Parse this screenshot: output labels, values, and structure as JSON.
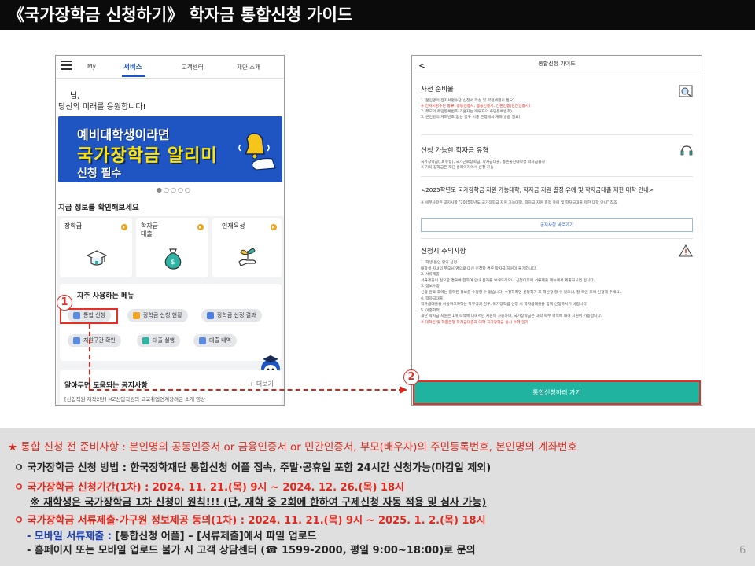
{
  "slide": {
    "title": "《국가장학금 신청하기》 학자금 통합신청 가이드",
    "page_number": "6"
  },
  "left_phone": {
    "nav": {
      "my": "My",
      "service": "서비스",
      "customer_center": "고객센터",
      "foundation": "재단 소개"
    },
    "greeting_line1": "님,",
    "greeting_line2": "당신의 미래를 응원합니다!",
    "banner": {
      "line1": "예비대학생이라면",
      "line2": "국가장학금 알리미",
      "line3": "신청 필수"
    },
    "carousel_dots": "●○○○○",
    "info_title": "지금 정보를 확인해보세요",
    "cards": [
      {
        "label": "장학금"
      },
      {
        "label": "학자금\n대출"
      },
      {
        "label": "인재육성"
      }
    ],
    "menu_title": "자주 사용하는 메뉴",
    "chips": [
      {
        "label": "통합 신청"
      },
      {
        "label": "장학금 신청 현황"
      },
      {
        "label": "장학금 선정 결과"
      },
      {
        "label": "지원구간 확인"
      },
      {
        "label": "대출 실행"
      },
      {
        "label": "대출 내역"
      }
    ],
    "notice_title": "알아두면 도움되는 공지사항",
    "more_link": "+ 더보기",
    "notice_item": "[신입직원 제작2탄] MZ신입직원의 고교취업연계장려금 소개 영상"
  },
  "right_phone": {
    "header_title": "통합신청 가이드",
    "back": "<",
    "prep": {
      "title": "사전 준비물",
      "lines": [
        "1. 본인명의 전자서명수단(신청서 작성 및 약정체결시 필요)",
        "※ 전자서명수단 종류: 공동인증서, 금융인증서, 간편인증(민간인증서)",
        "2. 부모의 주민등록번호(기혼자는 배우자의 주민등록번호)",
        "3. 본인명의 계좌번호(없는 경우 시중 은행에서 계좌 발급 필요)"
      ]
    },
    "types": {
      "title": "신청 가능한 학자금 유형",
      "lines": [
        "국가장학금(Ⅰ,Ⅱ 유형), 국가근로장학금, 학자금대출, 농촌출신대학생 학자금융자",
        "※ 기타 장학금은 재단 홈페이지에서 신청 가능"
      ]
    },
    "university": {
      "title": "<2025학년도 국가장학금 지원 가능대학, 학자금 지원 결정 유예 및 학자금대출 제한 대학 안내>",
      "line": "※ 세부사항은 공지사항 \"2025학년도 국가장학금 지원 가능대학, 학자금 지원 결정 유예 및 학자금대출 제한 대학 안내\" 참조",
      "button": "공지사항 바로가기"
    },
    "caution": {
      "title": "신청시 주의사항",
      "lines": [
        "1. 학생 본인 명의 신청",
        "대학생 자녀의 부모님 명의로 대신 신청할 경우 학자금 지원이 불가합니다.",
        "2. 서류제출",
        "서류제출이 필요한 경우에 한하여 안내 문자를 보내드리오니 신청이후에 서류제출 메뉴에서 제출하시면 됩니다.",
        "3. 정보수정",
        "신청 완료 후에는 입력된 정보를 수정할 수 없습니다. 수정하려면 신청하기 후 해산청 할 수 있으니, 잘 확인 후에 신청해 주세요.",
        "4. 학자금대출",
        "학자금대출을 이용하고자하는 학부생의 경우, 국가장학금 신청 시 학자금대출을 함께 신청하시기 바랍니다.",
        "5. 이중학적",
        "재단 학자금 지원은 1개 학적에 대해서만 지원이 가능하며, 국가장학금은 대학 학부 학적에 대해 지원이 가능합니다.",
        "※ 대학원 및 학점은행 학자금대출과 대학 국가장학금 동시 수혜 불가"
      ]
    },
    "go_button": "통합신청하러 가기"
  },
  "callouts": {
    "step1": "1",
    "step2": "2"
  },
  "notes": {
    "line1": "★ 통합 신청 전 준비사항 : 본인명의 공동인증서 or 금융인증서 or 민간인증서,  부모(배우자)의 주민등록번호, 본인명의 계좌번호",
    "line2": "ㅇ 국가장학금 신청 방법 : 한국장학재단 통합신청 어플 접속, 주말·공휴일 포함 24시간 신청가능(마감일 제외)",
    "line3": "ㅇ 국가장학금 신청기간(1차) : 2024. 11. 21.(목) 9시 ~ 2024. 12. 26.(목) 18시",
    "line4": "※ 재학생은 국가장학금 1차 신청이 원칙!!! (단, 재학 중 2회에 한하여 구제신청 자동 적용 및 심사 가능)",
    "line5": "ㅇ 국가장학금 서류제출·가구원 정보제공 동의(1차) : 2024. 11. 21.(목) 9시 ~ 2025. 1. 2.(목) 18시",
    "line6_prefix": "- 모바일 서류제출 : ",
    "line6_rest": "[통합신청 어플] – [서류제출]에서 파일 업로드",
    "line7": "- 홈페이지 또는 모바일 업로드 불가 시 고객 상담센터 (☎ 1599-2000, 평일 9:00~18:00)로 문의"
  },
  "colors": {
    "accent_red": "#e0291e",
    "accent_blue": "#1c3fae",
    "teal_button": "#20b4a0",
    "banner_blue": "#1f55c3",
    "banner_yellow": "#ffe400"
  }
}
